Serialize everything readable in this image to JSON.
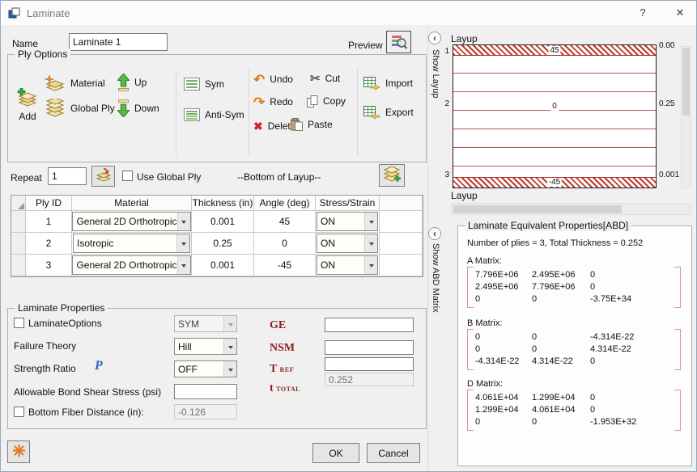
{
  "colors": {
    "label_red": "#8b1c1c",
    "layup_red": "#c0392b",
    "matrix_bracket_red": "#dc9898",
    "strength_p_blue": "#2563c9",
    "icon_orange": "#e07b1f",
    "delete_red": "#cc2a2a"
  },
  "dialog": {
    "title": "Laminate",
    "help_label": "?",
    "close_label": "✕"
  },
  "header": {
    "name_label": "Name",
    "name_value": "Laminate 1",
    "preview_label": "Preview"
  },
  "icons": {
    "undo": "↶",
    "redo": "↷",
    "delete": "✖",
    "cut": "✂",
    "chevron_left": "‹"
  },
  "ply_options": {
    "title": "Ply Options",
    "add": "Add",
    "material": "Material",
    "global_ply": "Global Ply",
    "up": "Up",
    "down": "Down",
    "sym": "Sym",
    "anti_sym": "Anti-Sym",
    "undo": "Undo",
    "redo": "Redo",
    "delete": "Delete",
    "cut": "Cut",
    "copy": "Copy",
    "paste": "Paste",
    "import": "Import",
    "export": "Export"
  },
  "repeat_row": {
    "label": "Repeat",
    "value": "1",
    "use_global_ply_label": "Use Global Ply",
    "bottom_of_layup_text": "--Bottom of Layup--"
  },
  "ply_table": {
    "headers": [
      "Ply ID",
      "Material",
      "Thickness (in)",
      "Angle (deg)",
      "Stress/Strain"
    ],
    "rows": [
      {
        "ply_id": "1",
        "material": "General 2D Orthotropic",
        "thickness": "0.001",
        "angle": "45",
        "stress_strain": "ON"
      },
      {
        "ply_id": "2",
        "material": "Isotropic",
        "thickness": "0.25",
        "angle": "0",
        "stress_strain": "ON"
      },
      {
        "ply_id": "3",
        "material": "General 2D Orthotropic",
        "thickness": "0.001",
        "angle": "-45",
        "stress_strain": "ON"
      }
    ]
  },
  "laminate_properties": {
    "title": "Laminate Properties",
    "laminate_options_label": "LaminateOptions",
    "laminate_options_value": "SYM",
    "failure_theory_label": "Failure Theory",
    "failure_theory_value": "Hill",
    "strength_ratio_label": "Strength Ratio",
    "strength_ratio_icon": "P",
    "strength_ratio_value": "OFF",
    "ge_label": "GE",
    "nsm_label": "NSM",
    "tref_label_main": "T",
    "tref_label_sub": "REF",
    "ttotal_label_main": "t",
    "ttotal_label_sub": "TOTAL",
    "ttotal_value": "0.252",
    "bond_shear_label": "Allowable Bond Shear Stress (psi)",
    "bottom_fiber_label": "Bottom Fiber Distance (in):",
    "bottom_fiber_value": "-0.126"
  },
  "footer": {
    "ok_label": "OK",
    "cancel_label": "Cancel"
  },
  "layup_panel": {
    "side_label": "Show Layup",
    "title": "Layup",
    "bottom_title": "Layup",
    "ply_numbers": [
      "1",
      "2",
      "3"
    ],
    "thickness_marks": [
      "0.00",
      "0.25",
      "0.001"
    ],
    "top_angle": "45",
    "mid_angle": "0",
    "bottom_angle": "-45"
  },
  "abd_panel": {
    "side_label": "Show ABD Matrix",
    "title": "Laminate Equivalent Properties[ABD]",
    "summary": "Number of plies = 3, Total Thickness = 0.252",
    "a_label": "A Matrix:",
    "b_label": "B Matrix:",
    "d_label": "D Matrix:",
    "a": [
      [
        "7.796E+06",
        "2.495E+06",
        "0"
      ],
      [
        "2.495E+06",
        "7.796E+06",
        "0"
      ],
      [
        "0",
        "0",
        "-3.75E+34"
      ]
    ],
    "b": [
      [
        "0",
        "0",
        "-4.314E-22"
      ],
      [
        "0",
        "0",
        "4.314E-22"
      ],
      [
        "-4.314E-22",
        "4.314E-22",
        "0"
      ]
    ],
    "d": [
      [
        "4.061E+04",
        "1.299E+04",
        "0"
      ],
      [
        "1.299E+04",
        "4.061E+04",
        "0"
      ],
      [
        "0",
        "0",
        "-1.953E+32"
      ]
    ]
  }
}
